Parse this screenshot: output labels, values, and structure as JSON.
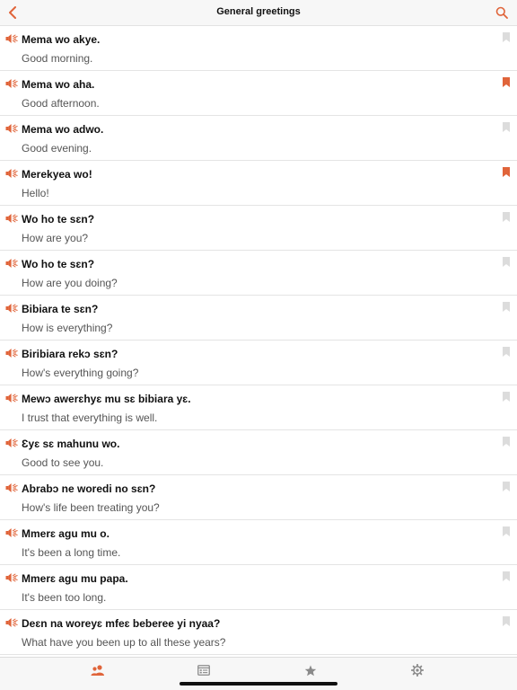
{
  "header": {
    "title": "General greetings"
  },
  "colors": {
    "accent": "#e0643a",
    "bookmark_inactive": "#dcdcdc",
    "tab_inactive": "#8a8a8a"
  },
  "phrases": [
    {
      "phrase": "Mema wo akye.",
      "translation": "Good morning.",
      "bookmarked": false
    },
    {
      "phrase": "Mema wo aha.",
      "translation": "Good afternoon.",
      "bookmarked": true
    },
    {
      "phrase": "Mema wo adwo.",
      "translation": "Good evening.",
      "bookmarked": false
    },
    {
      "phrase": "Merekyea wo!",
      "translation": "Hello!",
      "bookmarked": true
    },
    {
      "phrase": "Wo ho te sɛn?",
      "translation": "How are you?",
      "bookmarked": false
    },
    {
      "phrase": "Wo ho te sɛn?",
      "translation": "How are you doing?",
      "bookmarked": false
    },
    {
      "phrase": "Bibiara te sɛn?",
      "translation": "How is everything?",
      "bookmarked": false
    },
    {
      "phrase": "Biribiara rekɔ sɛn?",
      "translation": "How's everything going?",
      "bookmarked": false
    },
    {
      "phrase": "Mewɔ awerɛhyɛ mu sɛ bibiara yɛ.",
      "translation": "I trust that everything is well.",
      "bookmarked": false
    },
    {
      "phrase": "Ɛyɛ sɛ mahunu wo.",
      "translation": "Good to see you.",
      "bookmarked": false
    },
    {
      "phrase": "Abrabɔ ne woredi no sɛn?",
      "translation": "How's life been treating you?",
      "bookmarked": false
    },
    {
      "phrase": "Mmerɛ agu mu o.",
      "translation": "It's been a long time.",
      "bookmarked": false
    },
    {
      "phrase": "Mmerɛ agu mu papa.",
      "translation": "It's been too long.",
      "bookmarked": false
    },
    {
      "phrase": "Deɛn na woreyɛ mfeɛ beberee yi nyaa?",
      "translation": "What have you been up to all these years?",
      "bookmarked": false
    }
  ],
  "tabs": [
    {
      "name": "tab-phrases",
      "icon": "people-icon",
      "active": true
    },
    {
      "name": "tab-categories",
      "icon": "list-card-icon",
      "active": false
    },
    {
      "name": "tab-favorites",
      "icon": "star-icon",
      "active": false
    },
    {
      "name": "tab-settings",
      "icon": "gear-icon",
      "active": false
    }
  ]
}
